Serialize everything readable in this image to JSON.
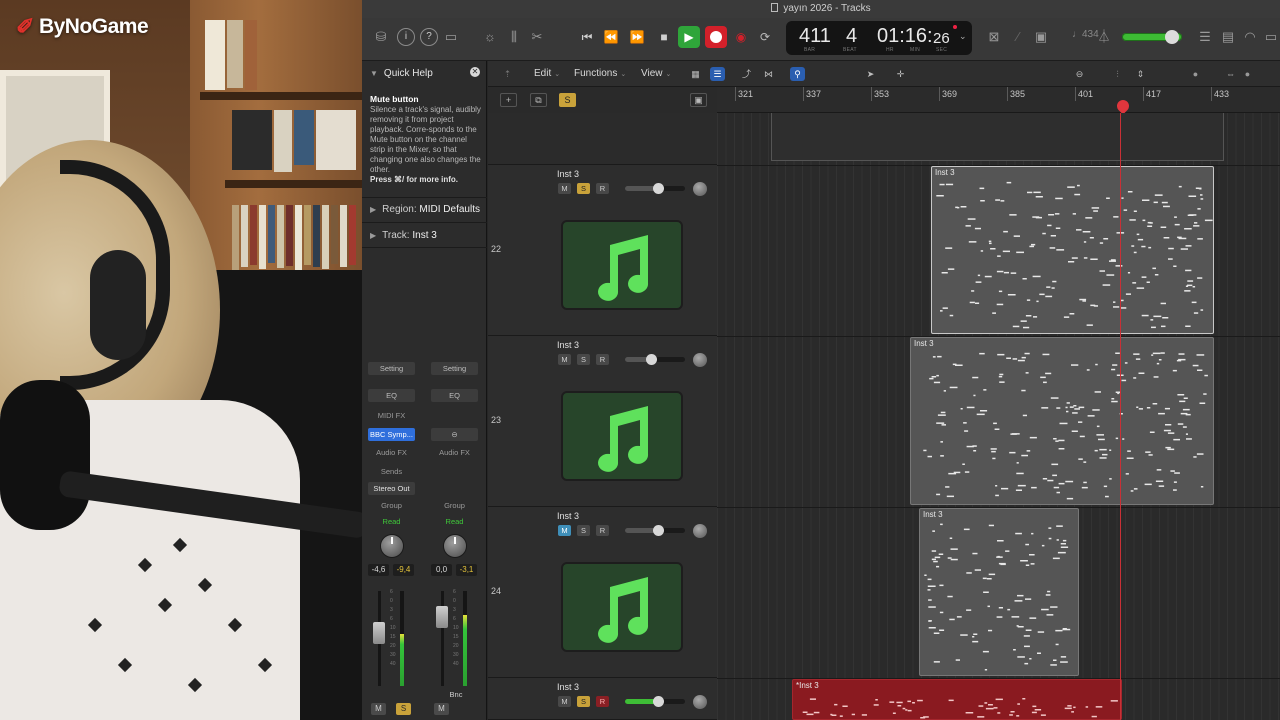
{
  "overlay": {
    "logo_text": "ByNoGame"
  },
  "window": {
    "title": "yayın 2026 - Tracks"
  },
  "lcd": {
    "bar": "411",
    "beat": "4",
    "time": "01:16:",
    "time_frames": "26",
    "bar_label": "BAR",
    "beat_label": "BEAT",
    "hr_label": "HR",
    "min_label": "MIN",
    "sec_label": "SEC"
  },
  "toolbar": {
    "key_text": "♩434"
  },
  "quick_help": {
    "header": "Quick Help",
    "title": "Mute button",
    "description": "Silence a track's signal, audibly removing it from project playback. Corre-sponds to the Mute button on the channel strip in the Mixer, so that changing one also changes the other.",
    "press": "Press ⌘/ for more info."
  },
  "inspector": {
    "region_label": "Region:",
    "region_value": "MIDI Defaults",
    "track_label": "Track:",
    "track_value": "Inst 3"
  },
  "channel_strips": [
    {
      "setting": "Setting",
      "eq": "EQ",
      "midi_fx": "MIDI FX",
      "plugin": "BBC Symp...",
      "audio_fx": "Audio FX",
      "sends": "Sends",
      "output": "Stereo Out",
      "group": "Group",
      "auto": "Read",
      "db_left": "-4,6",
      "db_right": "-9,4",
      "mute": "M",
      "solo": "S"
    },
    {
      "setting": "Setting",
      "eq": "EQ",
      "plugin": "⊖",
      "audio_fx": "Audio FX",
      "group": "Group",
      "auto": "Read",
      "db_left": "0,0",
      "db_right": "-3,1",
      "mute": "M",
      "bnc": "Bnc"
    }
  ],
  "tracks_menu": [
    "Edit",
    "Functions",
    "View"
  ],
  "ruler": {
    "bars": [
      "321",
      "337",
      "353",
      "369",
      "385",
      "401",
      "417",
      "433"
    ]
  },
  "header_strip": {
    "solo_label": "S"
  },
  "tracks": [
    {
      "number": "22",
      "name": "Inst 3",
      "m": "M",
      "s": "S",
      "r": "R",
      "mute": false,
      "solo": true,
      "rec": false
    },
    {
      "number": "23",
      "name": "Inst 3",
      "m": "M",
      "s": "S",
      "r": "R",
      "mute": false,
      "solo": false,
      "rec": false
    },
    {
      "number": "24",
      "name": "Inst 3",
      "m": "M",
      "s": "S",
      "r": "R",
      "mute": true,
      "solo": false,
      "rec": false
    },
    {
      "number": "",
      "name": "Inst 3",
      "m": "M",
      "s": "S",
      "r": "R",
      "mute": false,
      "solo": true,
      "rec": true
    }
  ],
  "regions": [
    {
      "name": "Inst 3"
    },
    {
      "name": "Inst 3"
    },
    {
      "name": "Inst 3"
    },
    {
      "name": "*Inst 3"
    }
  ],
  "colors": {
    "play": "#2fa53a",
    "record": "#d3202a",
    "region_red": "#8a1a20",
    "solo": "#c9a23a",
    "mute": "#3f8fb9",
    "icon_green": "#27452a"
  }
}
